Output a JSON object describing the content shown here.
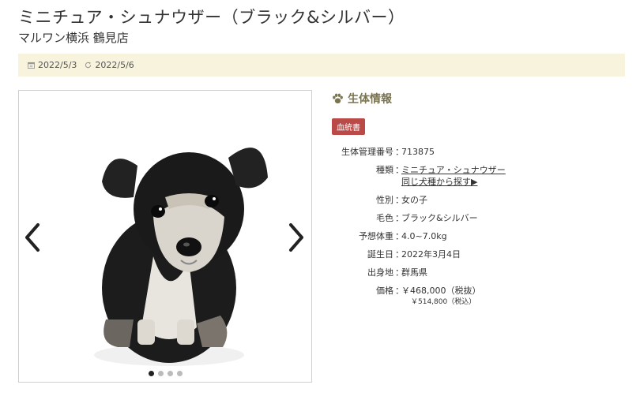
{
  "header": {
    "title": "ミニチュア・シュナウザー（ブラック&シルバー）",
    "shop": "マルワン横浜 鶴見店"
  },
  "dates": {
    "posted": "2022/5/3",
    "updated": "2022/5/6"
  },
  "gallery": {
    "image_count": 4,
    "active_index": 0
  },
  "info": {
    "heading": "生体情報",
    "badge": "血統書",
    "rows": [
      {
        "label": "生体管理番号",
        "value": "713875"
      },
      {
        "label": "種類",
        "value": "ミニチュア・シュナウザー",
        "link2": "同じ犬種から探す▶"
      },
      {
        "label": "性別",
        "value": "女の子"
      },
      {
        "label": "毛色",
        "value": "ブラック&シルバー"
      },
      {
        "label": "予想体重",
        "value": "4.0~7.0kg"
      },
      {
        "label": "誕生日",
        "value": "2022年3月4日"
      },
      {
        "label": "出身地",
        "value": "群馬県"
      },
      {
        "label": "価格",
        "value": "￥468,000（税抜）",
        "value2": "￥514,800（税込）"
      }
    ],
    "separator": "："
  },
  "colors": {
    "date_bar_bg": "#f7f3dd",
    "heading": "#7a7450",
    "badge_bg": "#b94a48"
  }
}
